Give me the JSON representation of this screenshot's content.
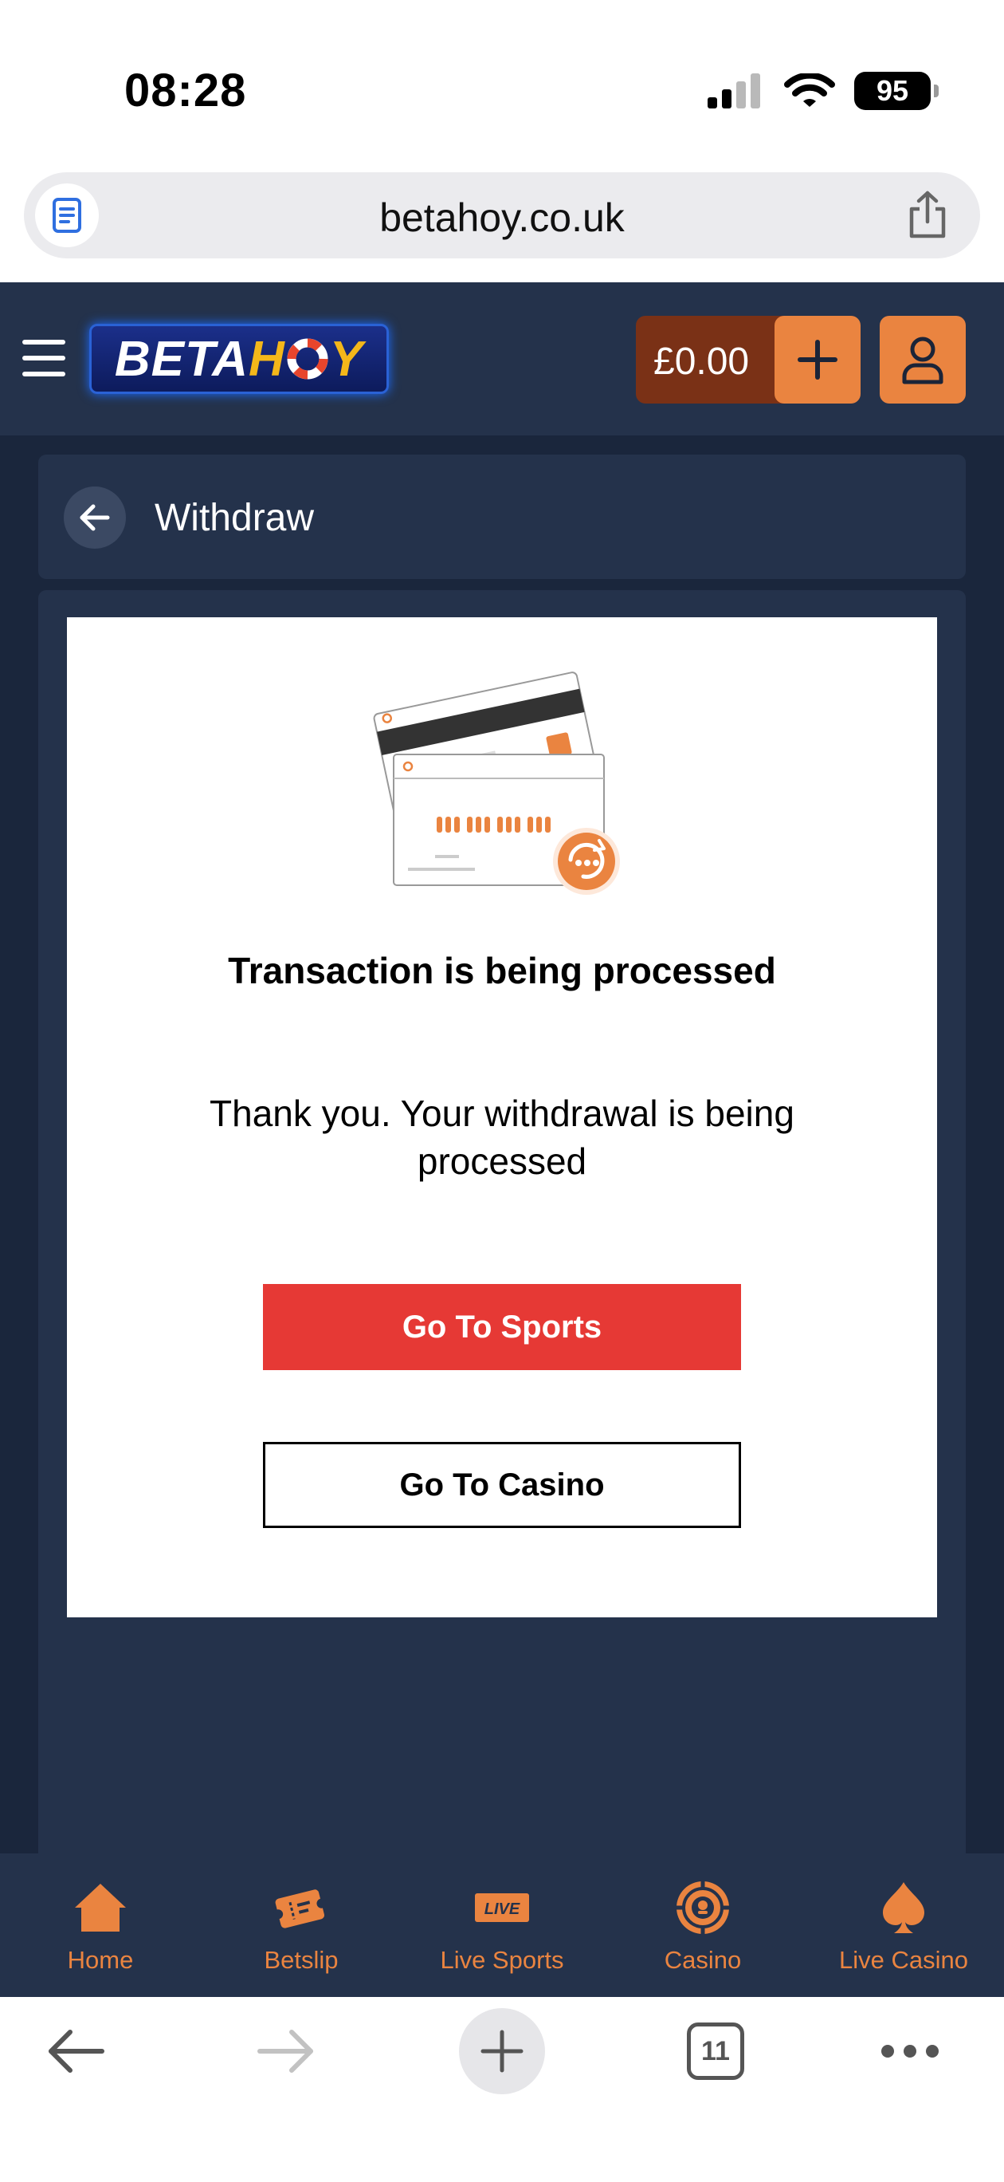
{
  "status_bar": {
    "time": "08:28",
    "battery": "95"
  },
  "browser": {
    "url": "betahoy.co.uk",
    "tab_count": "11"
  },
  "header": {
    "logo_part1": "BETA",
    "logo_part2": "H",
    "logo_part3": "Y",
    "balance": "£0.00"
  },
  "withdraw": {
    "title": "Withdraw"
  },
  "transaction": {
    "heading": "Transaction is being processed",
    "message": "Thank you. Your withdrawal is being processed",
    "sports_button": "Go To Sports",
    "casino_button": "Go To Casino"
  },
  "bottom_nav": {
    "items": [
      {
        "label": "Home",
        "icon": "home-icon"
      },
      {
        "label": "Betslip",
        "icon": "betslip-icon"
      },
      {
        "label": "Live Sports",
        "icon": "live-sports-icon"
      },
      {
        "label": "Casino",
        "icon": "casino-chip-icon"
      },
      {
        "label": "Live Casino",
        "icon": "spade-icon"
      }
    ],
    "live_badge": "LIVE"
  },
  "colors": {
    "brand_orange": "#ea8440",
    "header_bg": "#24324b",
    "page_bg": "#1a263c",
    "sports_red": "#e63935",
    "balance_brown": "#7a3116",
    "logo_gold": "#f4b71a"
  }
}
